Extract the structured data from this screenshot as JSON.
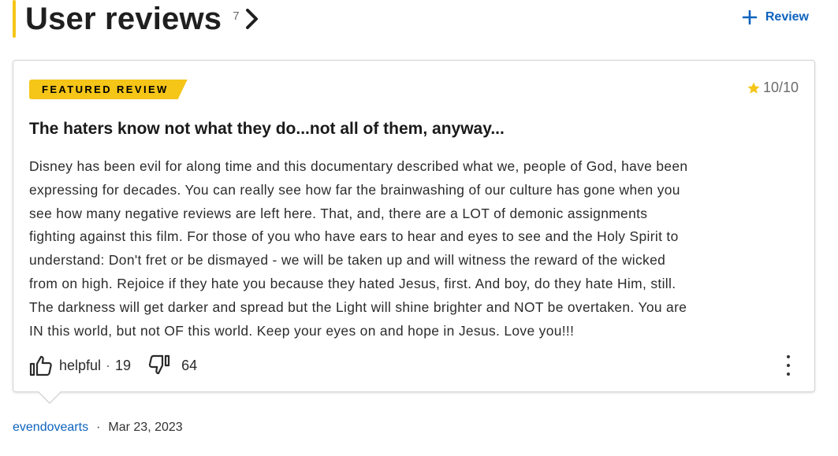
{
  "header": {
    "title": "User reviews",
    "count": "7",
    "add_review_label": "Review"
  },
  "review": {
    "badge": "FEATURED REVIEW",
    "rating": "10",
    "rating_max": "/10",
    "title": "The haters know not what they do...not all of them, anyway...",
    "body_lines": [
      "Disney has been evil for along time and this documentary described what we, people of God, have been",
      "expressing for decades. You can really see how far the brainwashing of our culture has gone when you",
      "see how many negative reviews are left here. That, and, there are a LOT of demonic assignments",
      "fighting against this film. For those of you who have ears to hear and eyes to see and the Holy Spirit to",
      "understand: Don't fret or be dismayed - we will be taken up and will witness the reward of the wicked",
      "from on high. Rejoice if they hate you because they hated Jesus, first. And boy, do they hate Him, still.",
      "The darkness will get darker and spread but the Light will shine brighter and NOT be overtaken. You are",
      "IN this world, but not OF this world. Keep your eyes on and hope in Jesus. Love you!!!"
    ],
    "helpful_label": "helpful",
    "helpful_separator": "·",
    "helpful_count": "19",
    "unhelpful_count": "64"
  },
  "author": {
    "name": "evendovearts",
    "separator": "·",
    "date": "Mar 23, 2023"
  },
  "colors": {
    "accent": "#f5c518",
    "link": "#0e63be"
  }
}
